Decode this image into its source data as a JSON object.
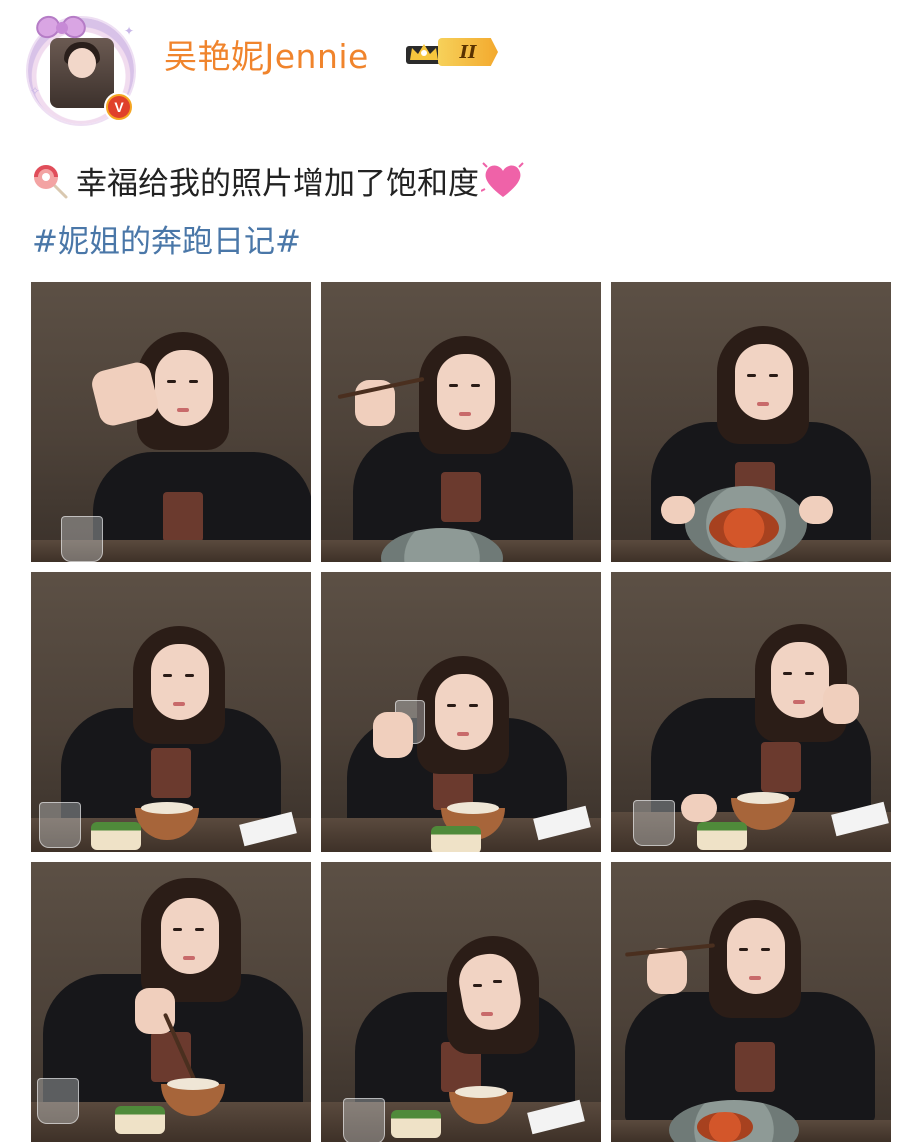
{
  "author": {
    "name": "吴艳妮Jennie",
    "avatar_icon": "bow-avatar-icon",
    "verified_icon": "verified-v-badge-icon",
    "verified_label": "V",
    "vip": {
      "crown_icon": "crown-icon",
      "level_label": "II",
      "color": "#f3a92e"
    },
    "name_color": "#f0842c"
  },
  "post": {
    "text": "幸福给我的照片增加了饱和度",
    "leading_emoji": "lollipop-icon",
    "trailing_emoji": "pink-heart-icon",
    "hashtag": "#妮姐的奔跑日记#",
    "hashtag_color": "#4a77a8"
  },
  "gallery": {
    "count": 9,
    "photos": [
      {
        "id": "photo-1",
        "subject": "woman at dinner table, hand raised near face"
      },
      {
        "id": "photo-2",
        "subject": "woman holding chopsticks, winking"
      },
      {
        "id": "photo-3",
        "subject": "woman holding plate of spaghetti"
      },
      {
        "id": "photo-4",
        "subject": "woman seated at table with bowl"
      },
      {
        "id": "photo-5",
        "subject": "woman raising water glass"
      },
      {
        "id": "photo-6",
        "subject": "woman leaning on hand at table"
      },
      {
        "id": "photo-7",
        "subject": "woman holding chopsticks over bowl"
      },
      {
        "id": "photo-8",
        "subject": "woman smiling, head tilted"
      },
      {
        "id": "photo-9",
        "subject": "woman holding chopsticks up"
      }
    ]
  }
}
